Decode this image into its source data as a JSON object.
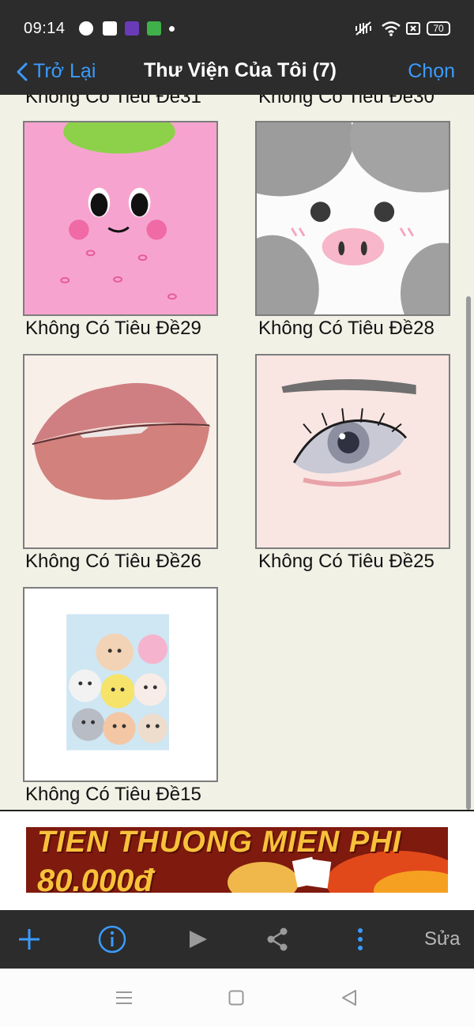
{
  "status_bar": {
    "time": "09:14",
    "battery": "70"
  },
  "nav": {
    "back_label": "Trở Lại",
    "title": "Thư Viện Của Tôi (7)",
    "select_label": "Chọn"
  },
  "gallery": {
    "partial_labels": [
      "Không Có Tiêu Đề31",
      "Không Có Tiêu Đề30"
    ],
    "items": [
      {
        "caption": "Không Có Tiêu Đề29"
      },
      {
        "caption": "Không Có Tiêu Đề28"
      },
      {
        "caption": "Không Có Tiêu Đề26"
      },
      {
        "caption": "Không Có Tiêu Đề25"
      },
      {
        "caption": "Không Có Tiêu Đề15"
      }
    ]
  },
  "ad": {
    "line1": "TIEN THUONG MIEN PHI",
    "line2": "80.000đ"
  },
  "toolbar": {
    "icons": [
      "plus-icon",
      "info-icon",
      "play-icon",
      "share-icon",
      "more-vertical-icon"
    ],
    "edit_label": "Sửa"
  },
  "colors": {
    "accent": "#3b9bff",
    "bar_bg": "#2b2c2b",
    "page_bg": "#f2f1e6"
  }
}
